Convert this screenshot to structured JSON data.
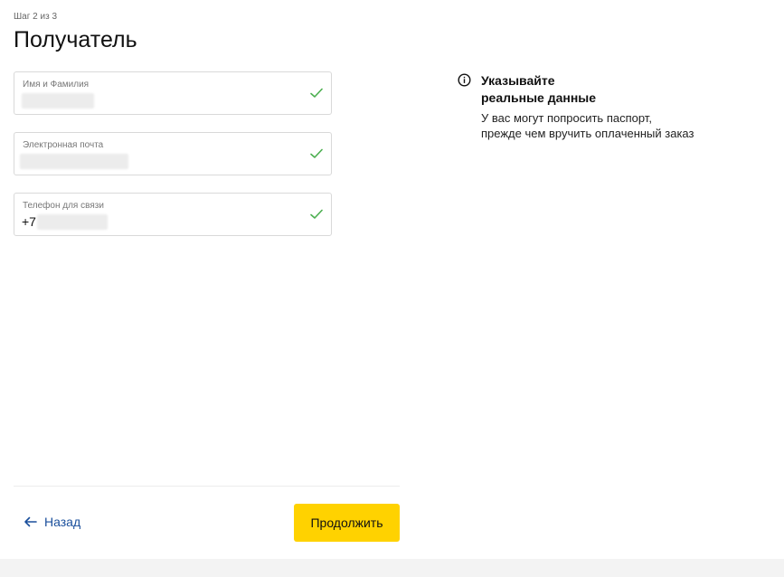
{
  "header": {
    "step": "Шаг 2 из 3",
    "title": "Получатель"
  },
  "form": {
    "name_field": {
      "label": "Имя и Фамилия",
      "value": ""
    },
    "email_field": {
      "label": "Электронная почта",
      "value": ""
    },
    "phone_field": {
      "label": "Телефон для связи",
      "value": "+7"
    }
  },
  "info": {
    "icon": "info-circle-icon",
    "title_line1": "Указывайте",
    "title_line2": "реальные данные",
    "text_line1": "У вас могут попросить паспорт,",
    "text_line2": "прежде чем вручить оплаченный заказ"
  },
  "actions": {
    "back_label": "Назад",
    "continue_label": "Продолжить"
  },
  "colors": {
    "accent_button": "#ffd200",
    "link": "#1a4f9c",
    "valid_check": "#4caf50"
  }
}
